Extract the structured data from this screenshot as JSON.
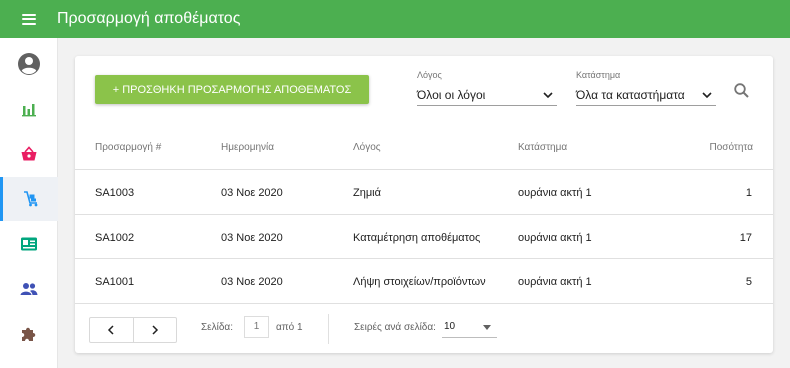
{
  "app": {
    "title": "Προσαρμογή αποθέματος"
  },
  "icons": {
    "menu": "menu-icon",
    "sidebar": [
      "account-circle-icon",
      "bar-chart-icon",
      "basket-icon",
      "inventory-cart-icon",
      "id-card-icon",
      "people-icon",
      "puzzle-icon"
    ],
    "search": "search-icon"
  },
  "colors": {
    "topbar": "#4caf50",
    "add_button": "#8bc34a",
    "active_nav": "#2196f3",
    "nav_icons": [
      "#616161",
      "#4caf50",
      "#e91e63",
      "#2196f3",
      "#00a67e",
      "#3f51b5",
      "#795548"
    ]
  },
  "toolbar": {
    "add_button_label": "+ ΠΡΟΣΘΗΚΗ ΠΡΟΣΑΡΜΟΓΗΣ ΑΠΟΘΕΜΑΤΟΣ",
    "reason_filter": {
      "label": "Λόγος",
      "value": "Όλοι οι λόγοι"
    },
    "store_filter": {
      "label": "Κατάστημα",
      "value": "Όλα τα καταστήματα"
    }
  },
  "table": {
    "columns": [
      "Προσαρμογή #",
      "Ημερομηνία",
      "Λόγος",
      "Κατάστημα",
      "Ποσότητα"
    ],
    "rows": [
      [
        "SA1003",
        "03 Νοε 2020",
        "Ζημιά",
        "ουράνια ακτή 1",
        "1"
      ],
      [
        "SA1002",
        "03 Νοε 2020",
        "Καταμέτρηση αποθέματος",
        "ουράνια ακτή 1",
        "17"
      ],
      [
        "SA1001",
        "03 Νοε 2020",
        "Λήψη στοιχείων/προϊόντων",
        "ουράνια ακτή 1",
        "5"
      ]
    ]
  },
  "pagination": {
    "page_label": "Σελίδα:",
    "page_value": "1",
    "of_label": "από 1",
    "rows_label": "Σειρές ανά σελίδα:",
    "rows_value": "10"
  }
}
